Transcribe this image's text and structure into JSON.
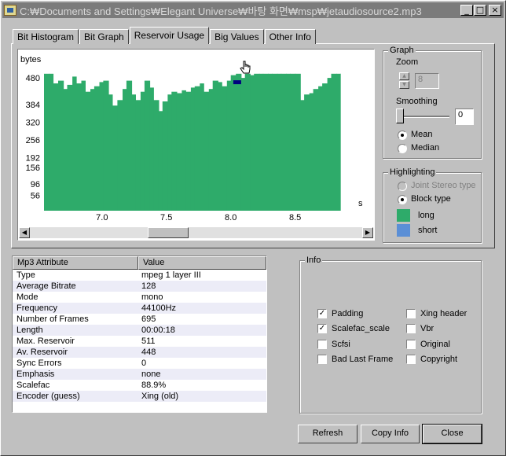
{
  "window": {
    "title": "C:₩Documents and Settings₩Elegant Universe₩바탕 화면₩msp₩jetaudiosource2.mp3",
    "controls": {
      "minimize": "_",
      "maximize": "□",
      "close": "×"
    }
  },
  "tabs": [
    {
      "label": "Bit Histogram",
      "active": false
    },
    {
      "label": "Bit Graph",
      "active": false
    },
    {
      "label": "Reservoir Usage",
      "active": true
    },
    {
      "label": "Big Values",
      "active": false
    },
    {
      "label": "Other Info",
      "active": false
    }
  ],
  "graph": {
    "group_label": "Graph",
    "zoom_label": "Zoom",
    "zoom_value": "8",
    "smoothing_label": "Smoothing",
    "smoothing_value": "0",
    "mean_label": "Mean",
    "median_label": "Median",
    "selected": "Mean"
  },
  "highlighting": {
    "group_label": "Highlighting",
    "joint_stereo_label": "Joint Stereo type",
    "block_type_label": "Block type",
    "selected": "Block type",
    "long_label": "long",
    "short_label": "short",
    "long_color": "#2eab6a",
    "short_color": "#5b8fd6"
  },
  "chart_data": {
    "type": "area",
    "ylabel": "bytes",
    "xlabel": "s",
    "yticks": [
      56,
      96,
      156,
      192,
      256,
      320,
      384,
      480
    ],
    "xticks": [
      "7.0",
      "7.5",
      "8.0",
      "8.5"
    ],
    "xlim": [
      6.55,
      8.85
    ],
    "ylim": [
      0,
      540
    ],
    "color": "#2eab6a",
    "marker_color": "#00007f",
    "marker_x": 8.05,
    "marker_y": 480,
    "x": [
      6.55,
      6.59,
      6.62,
      6.66,
      6.7,
      6.73,
      6.77,
      6.8,
      6.84,
      6.87,
      6.91,
      6.94,
      6.98,
      7.01,
      7.05,
      7.08,
      7.12,
      7.16,
      7.19,
      7.23,
      7.26,
      7.3,
      7.33,
      7.37,
      7.4,
      7.44,
      7.47,
      7.51,
      7.54,
      7.58,
      7.62,
      7.65,
      7.69,
      7.72,
      7.76,
      7.79,
      7.83,
      7.86,
      7.9,
      7.93,
      7.97,
      8.0,
      8.04,
      8.08,
      8.11,
      8.15,
      8.18,
      8.22,
      8.25,
      8.29,
      8.32,
      8.36,
      8.39,
      8.43,
      8.46,
      8.5,
      8.54,
      8.57,
      8.61,
      8.64,
      8.68,
      8.71,
      8.75,
      8.78,
      8.82,
      8.85
    ],
    "values": [
      495,
      495,
      460,
      470,
      440,
      455,
      485,
      460,
      470,
      430,
      440,
      450,
      465,
      470,
      420,
      380,
      400,
      440,
      470,
      420,
      400,
      430,
      470,
      445,
      400,
      360,
      395,
      420,
      430,
      425,
      435,
      430,
      445,
      450,
      460,
      430,
      440,
      470,
      465,
      450,
      470,
      490,
      495,
      480,
      495,
      490,
      495,
      495,
      495,
      495,
      495,
      495,
      495,
      495,
      495,
      495,
      400,
      420,
      425,
      440,
      450,
      460,
      480,
      495,
      495,
      495
    ]
  },
  "attributes": {
    "col_attribute": "Mp3 Attribute",
    "col_value": "Value",
    "rows": [
      {
        "name": "Type",
        "value": "mpeg 1 layer III"
      },
      {
        "name": "Average Bitrate",
        "value": "128"
      },
      {
        "name": "Mode",
        "value": "mono"
      },
      {
        "name": "Frequency",
        "value": "44100Hz"
      },
      {
        "name": "Number of Frames",
        "value": "695"
      },
      {
        "name": "Length",
        "value": "00:00:18"
      },
      {
        "name": "Max. Reservoir",
        "value": "511"
      },
      {
        "name": "Av. Reservoir",
        "value": "448"
      },
      {
        "name": "Sync Errors",
        "value": "0"
      },
      {
        "name": "Emphasis",
        "value": "none"
      },
      {
        "name": "Scalefac",
        "value": "88.9%"
      },
      {
        "name": "Encoder (guess)",
        "value": "Xing (old)"
      }
    ]
  },
  "info": {
    "group_label": "Info",
    "padding": {
      "label": "Padding",
      "checked": true
    },
    "scalefac_scale": {
      "label": "Scalefac_scale",
      "checked": true
    },
    "scfsi": {
      "label": "Scfsi",
      "checked": false
    },
    "bad_last_frame": {
      "label": "Bad Last Frame",
      "checked": false
    },
    "xing_header": {
      "label": "Xing header",
      "checked": false
    },
    "vbr": {
      "label": "Vbr",
      "checked": false
    },
    "original": {
      "label": "Original",
      "checked": false
    },
    "copyright": {
      "label": "Copyright",
      "checked": false
    }
  },
  "buttons": {
    "refresh": "Refresh",
    "copy_info": "Copy Info",
    "close": "Close"
  },
  "icons": {
    "app": "app-icon",
    "check": "✓",
    "scroll_left": "◀",
    "scroll_right": "▶",
    "spin_up": "▲",
    "spin_down": "▼"
  }
}
